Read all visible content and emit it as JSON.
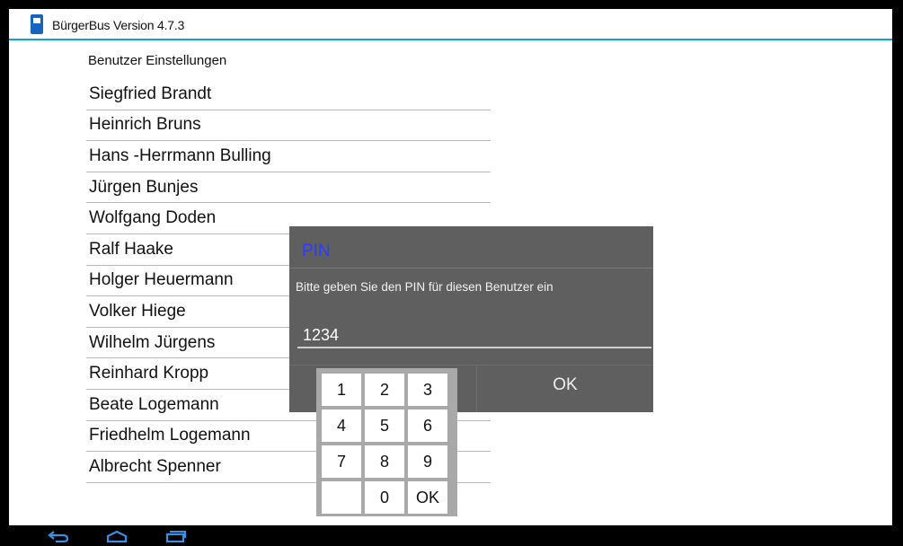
{
  "app": {
    "title": "BürgerBus Version 4.7.3",
    "icon": "app-bus-icon"
  },
  "page": {
    "heading": "Benutzer Einstellungen"
  },
  "users": [
    {
      "name": "Siegfried Brandt"
    },
    {
      "name": "Heinrich Bruns"
    },
    {
      "name": "Hans -Herrmann Bulling"
    },
    {
      "name": "Jürgen Bunjes"
    },
    {
      "name": "Wolfgang Doden"
    },
    {
      "name": "Ralf Haake"
    },
    {
      "name": "Holger Heuermann"
    },
    {
      "name": "Volker Hiege"
    },
    {
      "name": "Wilhelm Jürgens"
    },
    {
      "name": "Reinhard Kropp"
    },
    {
      "name": "Beate Logemann"
    },
    {
      "name": "Friedhelm Logemann"
    },
    {
      "name": "Albrecht Spenner"
    }
  ],
  "dialog": {
    "title": "PIN",
    "message": "Bitte geben Sie den PIN für diesen Benutzer ein",
    "pin_value": "1234",
    "ok_label": "OK",
    "title_color": "#2a3cff",
    "background_color": "#5f5f5f"
  },
  "numpad": {
    "keys": [
      "1",
      "2",
      "3",
      "4",
      "5",
      "6",
      "7",
      "8",
      "9",
      "",
      "0",
      "OK"
    ]
  },
  "navbar": {
    "icons": [
      "back-icon",
      "home-icon",
      "recent-apps-icon"
    ],
    "icon_color": "#3b8fe0"
  },
  "colors": {
    "accent": "#0aa6d6",
    "divider": "#b8b8b8"
  }
}
